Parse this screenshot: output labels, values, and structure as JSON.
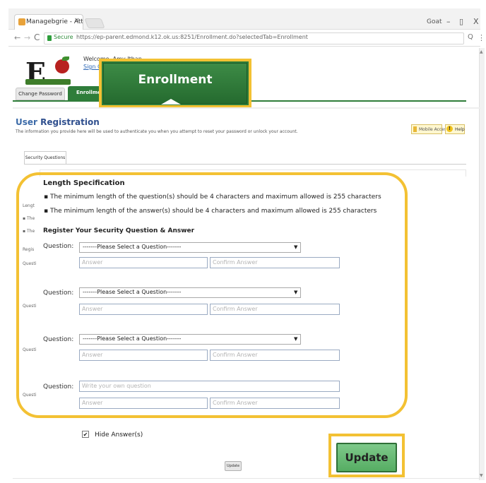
{
  "browser": {
    "tab_title": "Managebgrie - Atted",
    "tab_close": "×",
    "user": "Goat",
    "win_min": "–",
    "win_max": "▯",
    "win_close": "X",
    "secure_label": "Secure",
    "url": "https://ep-parent.edmond.k12.ok.us:8251/Enrollment.do?selectedTab=Enrollment",
    "back": "←",
    "forward": "→",
    "reload": "C",
    "zoom": "Q",
    "menu": "⋮"
  },
  "header": {
    "logo_letter": "E",
    "welcome": "Welcome, Amy Ithan",
    "signout": "Sign Out",
    "tabs": [
      {
        "label": "Change Password"
      },
      {
        "label": "Enrollment"
      }
    ],
    "callout_label": "Enrollment"
  },
  "registration": {
    "title_prefix": "User ",
    "title_bold": "Registration",
    "description": "The information you provide here will be used to authenticate you when you attempt to reset your password or unlock your account.",
    "mobile_access": "Mobile Access",
    "help": "Help",
    "help_glyph": "!",
    "subtab": "Security Questions"
  },
  "form": {
    "length_title": "Length Specification",
    "bullets": [
      "▪  The minimum length of the question(s) should be 4 characters and maximum allowed is 255 characters",
      "▪  The minimum length of the answer(s) should be 4 characters and maximum allowed is 255 characters"
    ],
    "ghost_labels": [
      "Lengt",
      "▪ The",
      "▪ The",
      "Regis",
      "Questi",
      "Questi",
      "Questi",
      "Questi"
    ],
    "subtitle": "Register Your Security Question & Answer",
    "question_label": "Question:",
    "select_default": "-------Please Select a Question-------",
    "select_arrow": "▼",
    "answer_placeholder": "Answer",
    "confirm_placeholder": "Confirm Answer",
    "own_question_placeholder": "Write your own question",
    "hide_check": "✔",
    "hide_label": "Hide Answer(s)"
  },
  "actions": {
    "small_update": "Update",
    "update": "Update"
  },
  "colors": {
    "highlight": "#f3c133",
    "enroll_green": "#2f7d3a",
    "update_green": "#6bbd78",
    "title_blue": "#3b6aa8"
  }
}
